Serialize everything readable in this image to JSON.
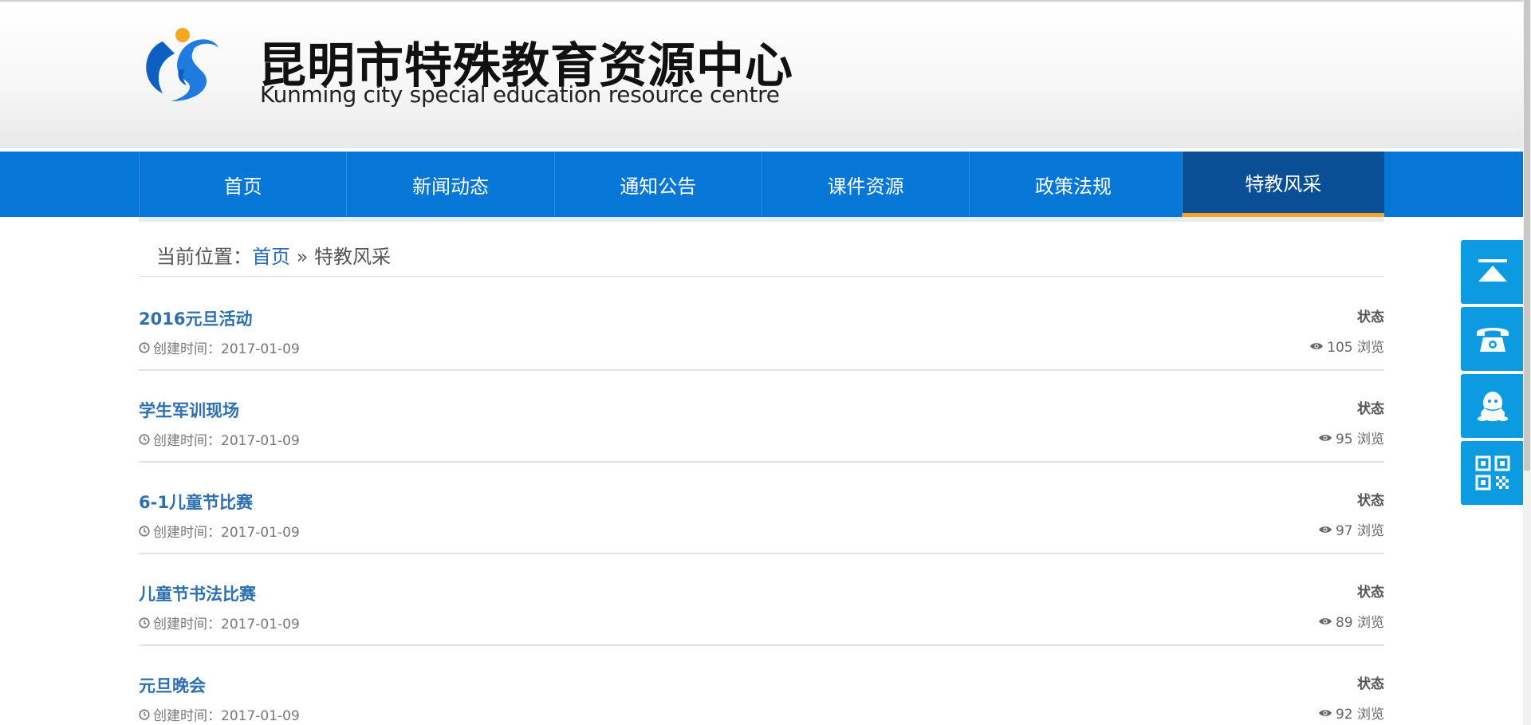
{
  "header": {
    "logo_cn": "昆明市特殊教育资源中心",
    "logo_en": "Kunming city special education resource centre"
  },
  "nav": {
    "items": [
      {
        "label": "首页"
      },
      {
        "label": "新闻动态"
      },
      {
        "label": "通知公告"
      },
      {
        "label": "课件资源"
      },
      {
        "label": "政策法规"
      },
      {
        "label": "特教风采"
      }
    ],
    "active_index": 5
  },
  "breadcrumb": {
    "prefix": "当前位置：",
    "home": "首页",
    "separator": "»",
    "current": "特教风采"
  },
  "list": {
    "items": [
      {
        "title": "2016元旦活动",
        "created": "创建时间：2017-01-09",
        "status": "状态",
        "views": "105 浏览"
      },
      {
        "title": "学生军训现场",
        "created": "创建时间：2017-01-09",
        "status": "状态",
        "views": "95 浏览"
      },
      {
        "title": "6-1儿童节比赛",
        "created": "创建时间：2017-01-09",
        "status": "状态",
        "views": "97 浏览"
      },
      {
        "title": "儿童节书法比赛",
        "created": "创建时间：2017-01-09",
        "status": "状态",
        "views": "89 浏览"
      },
      {
        "title": "元旦晚会",
        "created": "创建时间：2017-01-09",
        "status": "状态",
        "views": "92 浏览"
      }
    ]
  },
  "floatbar": {
    "buttons": [
      {
        "icon": "back-to-top-icon"
      },
      {
        "icon": "phone-icon"
      },
      {
        "icon": "qq-penguin-icon"
      },
      {
        "icon": "qr-code-icon"
      }
    ]
  },
  "colors": {
    "nav_blue": "#0677d6",
    "nav_active": "#0a4f96",
    "nav_active_underline": "#f5a623",
    "link_blue": "#2e6fb0",
    "float_blue": "#0c9ae0"
  }
}
